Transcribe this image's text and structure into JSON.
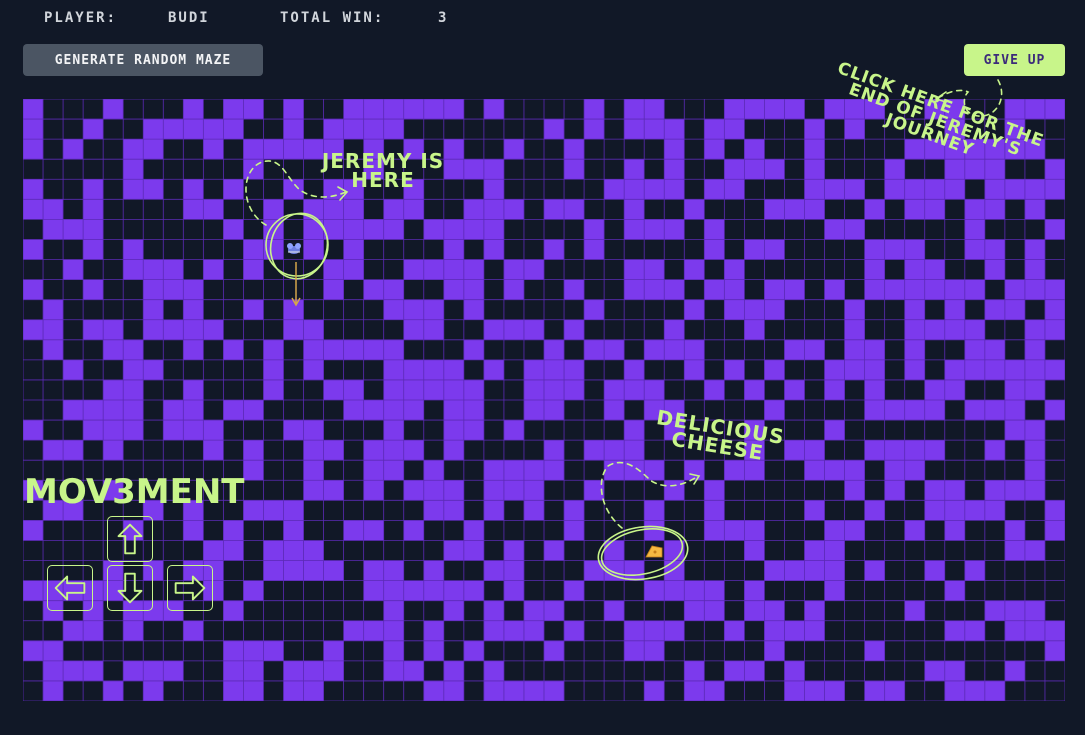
{
  "header": {
    "player_label": "PLAYER:",
    "player_name": "BUDI",
    "total_win_label": "TOTAL WIN:",
    "total_win_value": "3"
  },
  "toolbar": {
    "generate_label": "GENERATE RANDOM MAZE",
    "give_up_label": "GIVE UP"
  },
  "annotations": {
    "jeremy": "JEREMY IS HERE",
    "cheese": "DELICIOUS CHEESE",
    "end": "CLICK HERE FOR THE END OF JEREMY'S JOURNEY",
    "movement": "MOV3MENT"
  },
  "controls": [
    {
      "name": "up",
      "icon": "arrow-up-icon"
    },
    {
      "name": "left",
      "icon": "arrow-left-icon"
    },
    {
      "name": "down",
      "icon": "arrow-down-icon"
    },
    {
      "name": "right",
      "icon": "arrow-right-icon"
    }
  ],
  "maze": {
    "wall_color": "#7c3aed",
    "path_color": "#111827",
    "grid_color": "#5b2ab5",
    "accent_color": "#c8f58a",
    "mouse_icon": "mouse-icon",
    "cheese_icon": "cheese-icon"
  }
}
